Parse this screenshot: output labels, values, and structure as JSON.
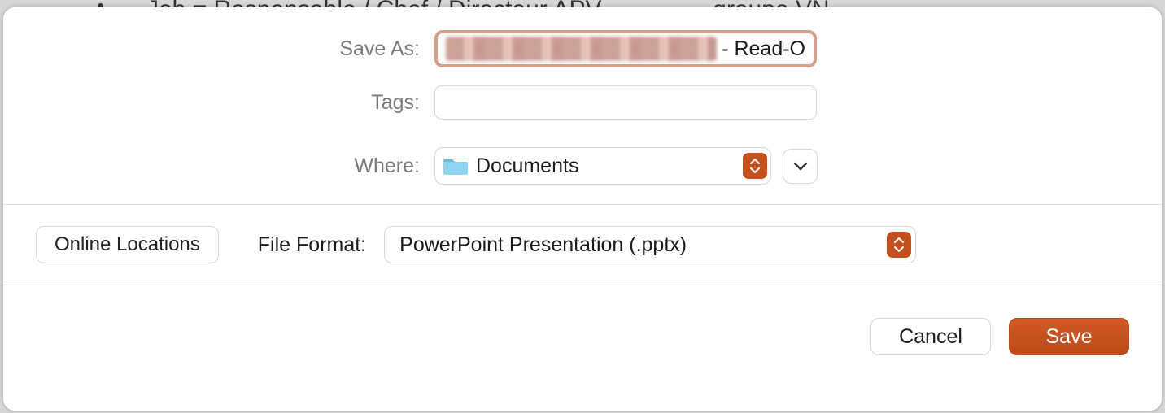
{
  "background": {
    "bullet_text": "Job = Responsable / Chef / Directeur APV",
    "right_fragment": "groupe VN"
  },
  "labels": {
    "save_as": "Save As:",
    "tags": "Tags:",
    "where": "Where:",
    "file_format": "File Format:"
  },
  "save_as": {
    "filename_obscured": true,
    "visible_suffix": " -  Read-O"
  },
  "tags": {
    "value": ""
  },
  "where": {
    "folder_name": "Documents",
    "folder_icon": "folder-icon"
  },
  "file_format": {
    "selected": "PowerPoint Presentation (.pptx)"
  },
  "buttons": {
    "online_locations": "Online Locations",
    "cancel": "Cancel",
    "save": "Save"
  },
  "accent_color": "#c4501e"
}
